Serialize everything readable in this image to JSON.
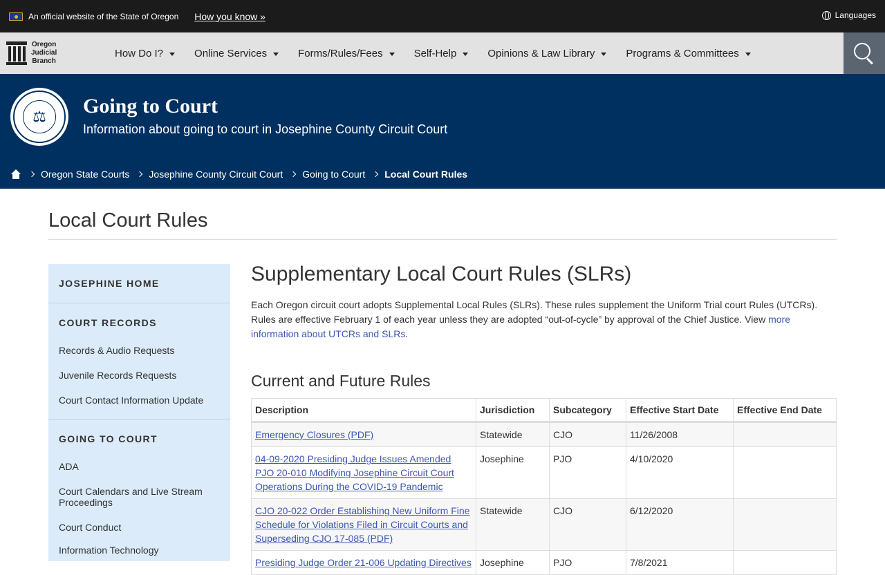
{
  "official_bar": {
    "text": "An official website of the State of Oregon",
    "how_link": "How you know »",
    "languages": "Languages"
  },
  "nav": {
    "brand": [
      "Oregon",
      "Judicial",
      "Branch"
    ],
    "items": [
      {
        "label": "How Do I?"
      },
      {
        "label": "Online Services"
      },
      {
        "label": "Forms/Rules/Fees"
      },
      {
        "label": "Self-Help"
      },
      {
        "label": "Opinions & Law Library"
      },
      {
        "label": "Programs & Committees"
      }
    ]
  },
  "hero": {
    "title": "Going to Court",
    "subtitle": "Information about going to court in Josephine County Circuit Court"
  },
  "breadcrumb": {
    "items": [
      "Oregon State Courts",
      "Josephine County Circuit Court",
      "Going to Court"
    ],
    "current": "Local Court Rules"
  },
  "page_title": "Local Court Rules",
  "sidebar": {
    "home": "JOSEPHINE HOME",
    "records_head": "COURT RECORDS",
    "records_links": [
      "Records & Audio Requests",
      "Juvenile Records Requests",
      "Court Contact Information Update"
    ],
    "going_head": "GOING TO COURT",
    "going_links": [
      "ADA",
      "Court Calendars and Live Stream Proceedings",
      "Court Conduct",
      "Information Technology"
    ]
  },
  "content": {
    "heading": "Supplementary Local Court Rules (SLRs)",
    "intro": "Each Oregon circuit court adopts Supplemental Local Rules (SLRs). These rules supplement the Uniform Trial court Rules (UTCRs). Rules are effective February 1 of each year unless they are adopted “out-of-cycle” by approval of the Chief Justice. View ",
    "intro_link": "more information about UTCRs and SLRs",
    "intro_end": ".",
    "subheading": "Current and Future Rules",
    "table": {
      "headers": [
        "Description",
        "Jurisdiction",
        "Subcategory",
        "Effective Start Date",
        "Effective End Date"
      ],
      "rows": [
        {
          "desc": "Emergency Closures (PDF)",
          "jur": "Statewide",
          "sub": "CJO",
          "start": "11/26/2008",
          "end": ""
        },
        {
          "desc": "04-09-2020 Presiding Judge Issues Amended PJO 20-010 Modifying Josephine Circuit Court Operations During the COVID-19 Pandemic",
          "jur": "Josephine",
          "sub": "PJO",
          "start": "4/10/2020",
          "end": ""
        },
        {
          "desc": "CJO 20-022 Order Establishing New Uniform Fine Schedule for Violations Filed in Circuit Courts and Superseding CJO 17-085 (PDF)",
          "jur": "Statewide",
          "sub": "CJO",
          "start": "6/12/2020",
          "end": ""
        },
        {
          "desc": "Presiding Judge Order 21-006 Updating Directives",
          "jur": "Josephine",
          "sub": "PJO",
          "start": "7/8/2021",
          "end": ""
        }
      ]
    }
  }
}
